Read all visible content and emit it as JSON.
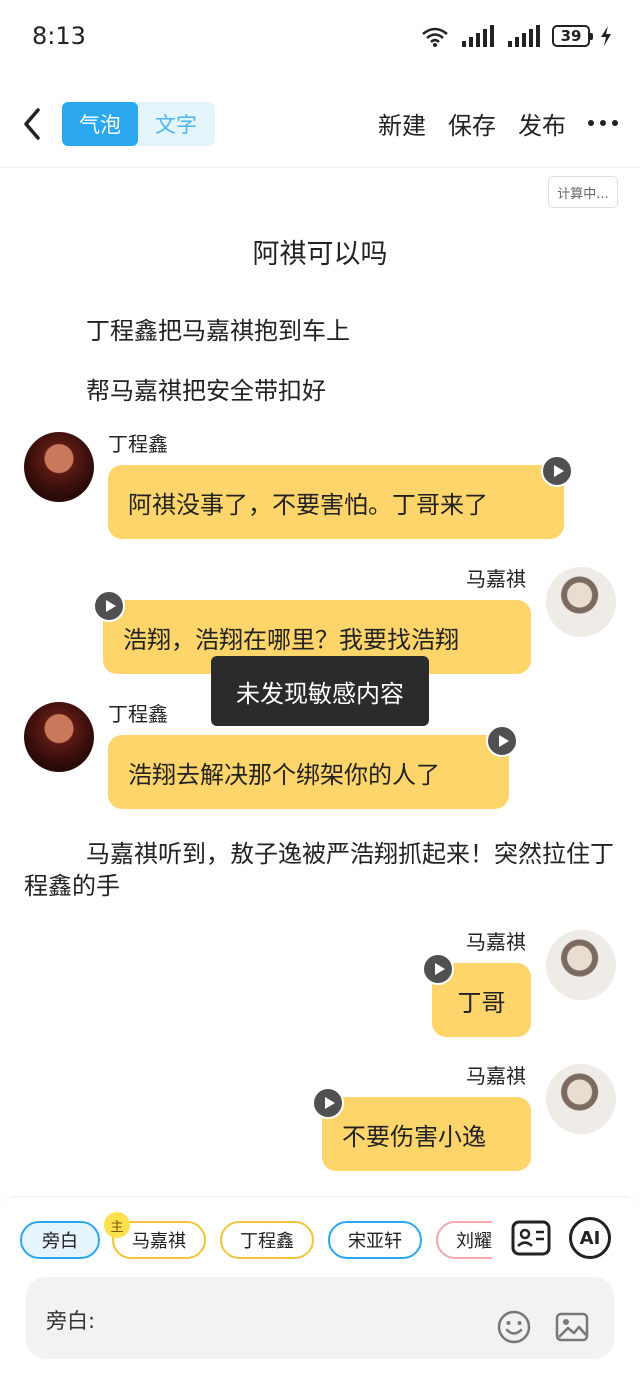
{
  "status": {
    "time": "8:13",
    "battery": "39",
    "network_label": "6"
  },
  "nav": {
    "tab_bubble": "气泡",
    "tab_text": "文字",
    "new_label": "新建",
    "save_label": "保存",
    "publish_label": "发布"
  },
  "calc_badge": "计算中...",
  "story_title": "阿祺可以吗",
  "narrations": [
    "丁程鑫把马嘉祺抱到车上",
    "帮马嘉祺把安全带扣好",
    "马嘉祺听到，敖子逸被严浩翔抓起来！突然拉住丁程鑫的手"
  ],
  "messages": [
    {
      "speaker": "丁程鑫",
      "text": "阿祺没事了，不要害怕。丁哥来了",
      "side": "left"
    },
    {
      "speaker": "马嘉祺",
      "text": "浩翔，浩翔在哪里？我要找浩翔",
      "side": "right"
    },
    {
      "speaker": "丁程鑫",
      "text": "浩翔去解决那个绑架你的人了",
      "side": "left"
    },
    {
      "speaker": "马嘉祺",
      "text": "丁哥",
      "side": "right"
    },
    {
      "speaker": "马嘉祺",
      "text": "不要伤害小逸",
      "side": "right"
    }
  ],
  "toast": "未发现敏感内容",
  "composer": {
    "chips": [
      "旁白",
      "马嘉祺",
      "丁程鑫",
      "宋亚轩",
      "刘耀"
    ],
    "main_badge": "主",
    "ai_label": "AI",
    "input_label": "旁白:"
  },
  "colors": {
    "accent": "#2aa7ee",
    "bubble": "#fdd56a",
    "toast": "#2b2b2b"
  }
}
